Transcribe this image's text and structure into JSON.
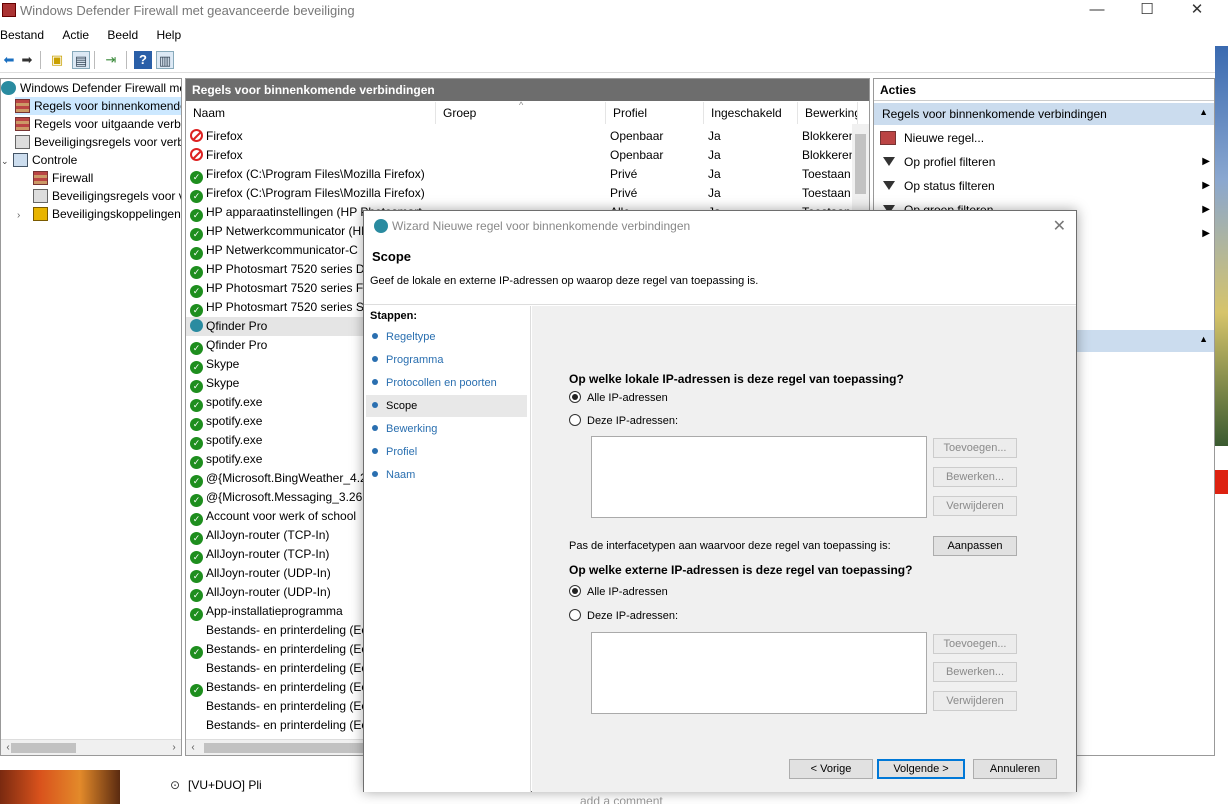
{
  "window": {
    "title": "Windows Defender Firewall met geavanceerde beveiliging",
    "min": "—",
    "max": "☐",
    "close": "✕"
  },
  "menu": [
    "Bestand",
    "Actie",
    "Beeld",
    "Help"
  ],
  "tree": {
    "root": "Windows Defender Firewall met geavanceerde beveiliging",
    "items": [
      "Regels voor binnenkomende verbindingen",
      "Regels voor uitgaande verbindingen",
      "Beveiligingsregels voor verbindingen",
      "Controle",
      "Firewall",
      "Beveiligingsregels voor verbindingen",
      "Beveiligingskoppelingen"
    ]
  },
  "list": {
    "header": "Regels voor binnenkomende verbindingen",
    "columns": [
      "Naam",
      "Groep",
      "Profiel",
      "Ingeschakeld",
      "Bewerking"
    ],
    "rows": [
      {
        "icon": "blocked",
        "name": "Firefox",
        "profile": "Openbaar",
        "enabled": "Ja",
        "action": "Blokkeren"
      },
      {
        "icon": "blocked",
        "name": "Firefox",
        "profile": "Openbaar",
        "enabled": "Ja",
        "action": "Blokkeren"
      },
      {
        "icon": "allowed",
        "name": "Firefox (C:\\Program Files\\Mozilla Firefox)",
        "profile": "Privé",
        "enabled": "Ja",
        "action": "Toestaan"
      },
      {
        "icon": "allowed",
        "name": "Firefox (C:\\Program Files\\Mozilla Firefox)",
        "profile": "Privé",
        "enabled": "Ja",
        "action": "Toestaan"
      },
      {
        "icon": "allowed",
        "name": "HP apparaatinstellingen (HP Photosmart",
        "profile": "Alle",
        "enabled": "Ja",
        "action": "Toestaan"
      },
      {
        "icon": "allowed",
        "name": "HP Netwerkcommunicator (HP",
        "profile": "",
        "enabled": "",
        "action": ""
      },
      {
        "icon": "allowed",
        "name": "HP Netwerkcommunicator-C",
        "profile": "",
        "enabled": "",
        "action": ""
      },
      {
        "icon": "allowed",
        "name": "HP Photosmart 7520 series Di",
        "profile": "",
        "enabled": "",
        "action": ""
      },
      {
        "icon": "allowed",
        "name": "HP Photosmart 7520 series Fa",
        "profile": "",
        "enabled": "",
        "action": ""
      },
      {
        "icon": "allowed",
        "name": "HP Photosmart 7520 series Se",
        "profile": "",
        "enabled": "",
        "action": ""
      },
      {
        "icon": "qfinder",
        "name": "Qfinder Pro",
        "profile": "",
        "enabled": "",
        "action": "",
        "selected": true
      },
      {
        "icon": "allowed",
        "name": "Qfinder Pro",
        "profile": "",
        "enabled": "",
        "action": ""
      },
      {
        "icon": "allowed",
        "name": "Skype",
        "profile": "",
        "enabled": "",
        "action": ""
      },
      {
        "icon": "allowed",
        "name": "Skype",
        "profile": "",
        "enabled": "",
        "action": ""
      },
      {
        "icon": "allowed",
        "name": "spotify.exe",
        "profile": "",
        "enabled": "",
        "action": ""
      },
      {
        "icon": "allowed",
        "name": "spotify.exe",
        "profile": "",
        "enabled": "",
        "action": ""
      },
      {
        "icon": "allowed",
        "name": "spotify.exe",
        "profile": "",
        "enabled": "",
        "action": ""
      },
      {
        "icon": "allowed",
        "name": "spotify.exe",
        "profile": "",
        "enabled": "",
        "action": ""
      },
      {
        "icon": "allowed",
        "name": "@{Microsoft.BingWeather_4.2",
        "profile": "",
        "enabled": "",
        "action": ""
      },
      {
        "icon": "allowed",
        "name": "@{Microsoft.Messaging_3.26.",
        "profile": "",
        "enabled": "",
        "action": ""
      },
      {
        "icon": "allowed",
        "name": "Account voor werk of school",
        "profile": "",
        "enabled": "",
        "action": ""
      },
      {
        "icon": "allowed",
        "name": "AllJoyn-router (TCP-In)",
        "profile": "",
        "enabled": "",
        "action": ""
      },
      {
        "icon": "allowed",
        "name": "AllJoyn-router (TCP-In)",
        "profile": "",
        "enabled": "",
        "action": ""
      },
      {
        "icon": "allowed",
        "name": "AllJoyn-router (UDP-In)",
        "profile": "",
        "enabled": "",
        "action": ""
      },
      {
        "icon": "allowed",
        "name": "AllJoyn-router (UDP-In)",
        "profile": "",
        "enabled": "",
        "action": ""
      },
      {
        "icon": "allowed",
        "name": "App-installatieprogramma",
        "profile": "",
        "enabled": "",
        "action": ""
      },
      {
        "icon": "none",
        "name": "Bestands- en printerdeling (Ec",
        "profile": "",
        "enabled": "",
        "action": ""
      },
      {
        "icon": "allowed",
        "name": "Bestands- en printerdeling (Ec",
        "profile": "",
        "enabled": "",
        "action": ""
      },
      {
        "icon": "none",
        "name": "Bestands- en printerdeling (Ec",
        "profile": "",
        "enabled": "",
        "action": ""
      },
      {
        "icon": "allowed",
        "name": "Bestands- en printerdeling (Ec",
        "profile": "",
        "enabled": "",
        "action": ""
      },
      {
        "icon": "none",
        "name": "Bestands- en printerdeling (Ec",
        "profile": "",
        "enabled": "",
        "action": ""
      },
      {
        "icon": "none",
        "name": "Bestands- en printerdeling (Ec",
        "profile": "",
        "enabled": "",
        "action": ""
      }
    ]
  },
  "actions": {
    "header": "Acties",
    "section": "Regels voor binnenkomende verbindingen",
    "items": [
      "Nieuwe regel...",
      "Op profiel filteren",
      "Op status filteren",
      "Op groep filteren"
    ]
  },
  "bottom": {
    "tab": "[VU+DUO] Pli",
    "comment": "add a comment"
  },
  "wizard": {
    "title": "Wizard Nieuwe regel voor binnenkomende verbindingen",
    "heading": "Scope",
    "subheading": "Geef de lokale en externe IP-adressen op waarop deze regel van toepassing is.",
    "steps_label": "Stappen:",
    "steps": [
      "Regeltype",
      "Programma",
      "Protocollen en poorten",
      "Scope",
      "Bewerking",
      "Profiel",
      "Naam"
    ],
    "current_step": 3,
    "local_question": "Op welke lokale IP-adressen is deze regel van toepassing?",
    "remote_question": "Op welke externe IP-adressen is deze regel van toepassing?",
    "all_ip": "Alle IP-adressen",
    "these_ip": "Deze IP-adressen:",
    "add": "Toevoegen...",
    "edit": "Bewerken...",
    "remove": "Verwijderen",
    "interface_text": "Pas de interfacetypen aan waarvoor deze regel van toepassing is:",
    "customize": "Aanpassen",
    "back": "< Vorige",
    "next": "Volgende >",
    "cancel": "Annuleren"
  }
}
